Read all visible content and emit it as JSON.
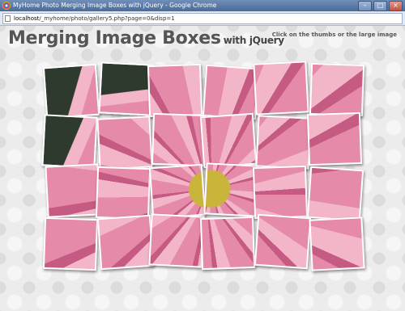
{
  "browser": {
    "window_title": "MyHome Photo Merging Image Boxes with jQuery - Google Chrome",
    "url_host": "localhost",
    "url_path": "/_myhome/photo/gallery5.php?page=0&disp=1",
    "controls": {
      "minimize": "–",
      "maximize": "□",
      "close": "×"
    }
  },
  "page": {
    "title": "Merging Image Boxes",
    "subtitle": "with jQuery",
    "hint": "Click on the thumbs or the large image"
  },
  "gallery": {
    "rows": 4,
    "cols": 6,
    "photo_colors": {
      "petal": "#e58aa8",
      "petal_light": "#f3b6c8",
      "leaf": "#2f3a2e",
      "center": "#c9b53a"
    }
  }
}
